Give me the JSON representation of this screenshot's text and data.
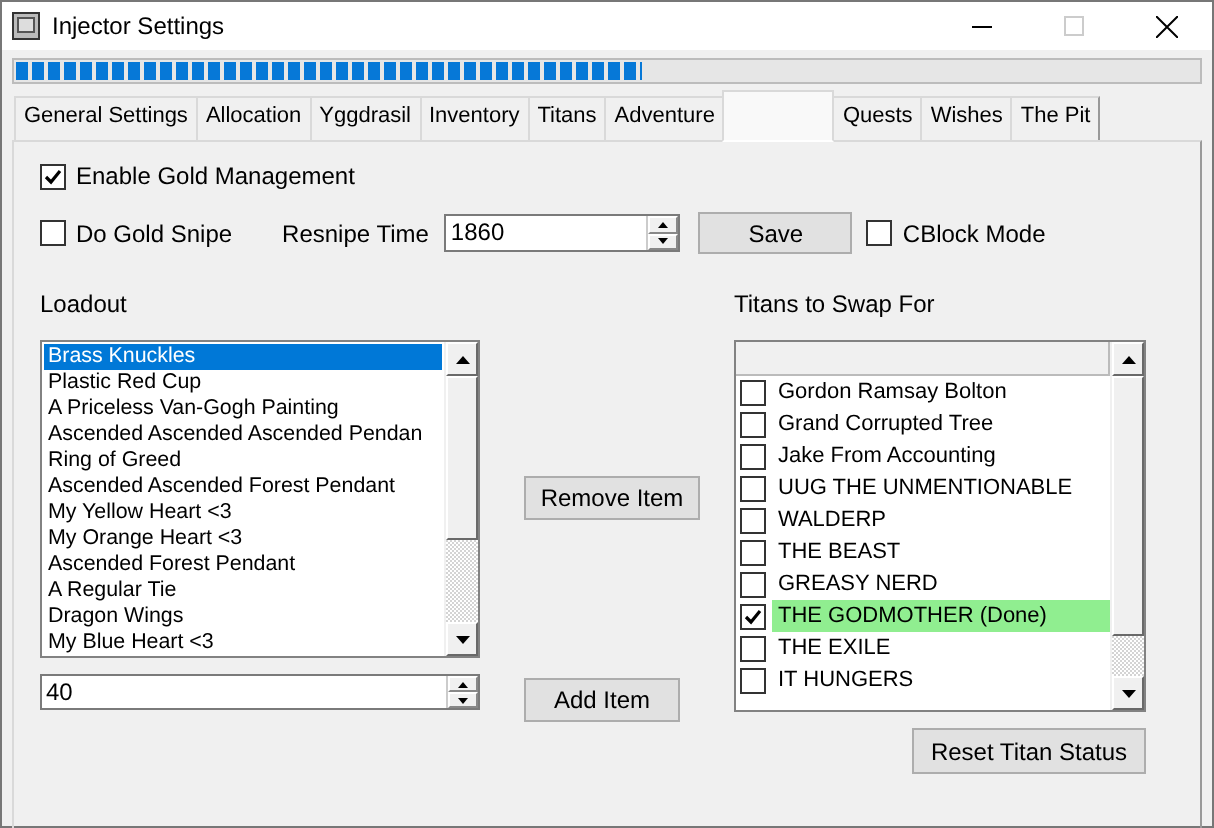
{
  "window": {
    "title": "Injector Settings"
  },
  "progress": {
    "level": 0.53
  },
  "tabs": [
    {
      "label": "General Settings",
      "selected": false
    },
    {
      "label": "Allocation",
      "selected": false
    },
    {
      "label": "Yggdrasil",
      "selected": false
    },
    {
      "label": "Inventory",
      "selected": false
    },
    {
      "label": "Titans",
      "selected": false
    },
    {
      "label": "Adventure",
      "selected": false
    },
    {
      "selected": true
    },
    {
      "label": "Quests",
      "selected": false
    },
    {
      "label": "Wishes",
      "selected": false
    },
    {
      "label": "The Pit",
      "selected": false
    }
  ],
  "gold": {
    "enable": {
      "label": "Enable Gold Management",
      "checked": true
    },
    "snipe": {
      "label": "Do Gold Snipe",
      "checked": false
    },
    "resnipe_label": "Resnipe Time",
    "resnipe_value": "1860",
    "save": "Save",
    "cblock": {
      "label": "CBlock Mode",
      "checked": false
    }
  },
  "loadout": {
    "title": "Loadout",
    "items": [
      {
        "label": "Brass Knuckles",
        "selected": true
      },
      {
        "label": "Plastic Red Cup",
        "selected": false
      },
      {
        "label": "A Priceless Van-Gogh Painting",
        "selected": false
      },
      {
        "label": "Ascended Ascended Ascended Pendan",
        "selected": false
      },
      {
        "label": "Ring of Greed",
        "selected": false
      },
      {
        "label": "Ascended Ascended Forest Pendant",
        "selected": false
      },
      {
        "label": "My Yellow Heart <3",
        "selected": false
      },
      {
        "label": "My Orange Heart <3",
        "selected": false
      },
      {
        "label": "Ascended Forest Pendant",
        "selected": false
      },
      {
        "label": "A Regular Tie",
        "selected": false
      },
      {
        "label": "Dragon Wings",
        "selected": false
      },
      {
        "label": "My Blue Heart <3",
        "selected": false
      }
    ],
    "number": "40",
    "remove": "Remove Item",
    "add": "Add Item"
  },
  "titans": {
    "title": "Titans to Swap For",
    "items": [
      {
        "label": "Gordon Ramsay Bolton",
        "checked": false
      },
      {
        "label": "Grand Corrupted Tree",
        "checked": false
      },
      {
        "label": "Jake From Accounting",
        "checked": false
      },
      {
        "label": "UUG THE UNMENTIONABLE",
        "checked": false
      },
      {
        "label": "WALDERP",
        "checked": false
      },
      {
        "label": "THE BEAST",
        "checked": false
      },
      {
        "label": "GREASY NERD",
        "checked": false
      },
      {
        "label": "THE GODMOTHER (Done)",
        "checked": true,
        "color": "#90ee90"
      },
      {
        "label": "THE EXILE",
        "checked": false
      },
      {
        "label": "IT HUNGERS",
        "checked": false
      }
    ],
    "reset": "Reset Titan Status"
  }
}
